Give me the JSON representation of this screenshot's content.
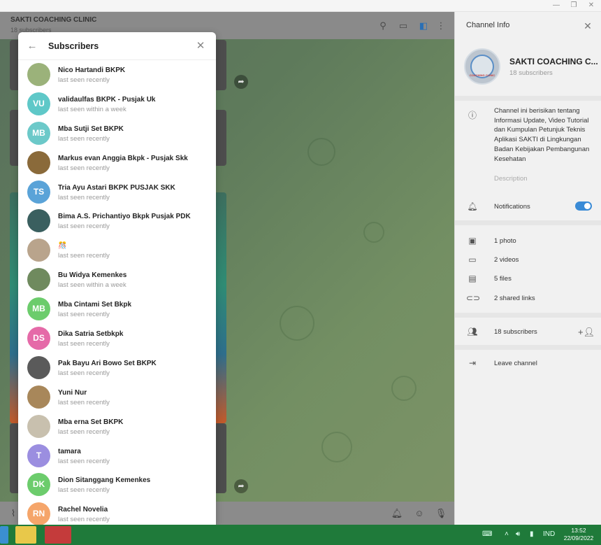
{
  "window": {
    "minimize_icon": "minimize-icon",
    "restore_icon": "restore-icon",
    "close_icon": "close-icon"
  },
  "chat": {
    "title": "SAKTI COACHING CLINIC",
    "subtitle": "18 subscribers"
  },
  "dialog": {
    "title": "Subscribers",
    "subscribers": [
      {
        "name": "Nico Hartandi BKPK",
        "status": "last seen recently",
        "initials": "",
        "color": "#9bb27a"
      },
      {
        "name": "validaulfas BKPK - Pusjak Uk",
        "status": "last seen within a week",
        "initials": "VU",
        "color": "#5fc8c8"
      },
      {
        "name": "Mba Sutji Set BKPK",
        "status": "last seen recently",
        "initials": "MB",
        "color": "#6cc9c9"
      },
      {
        "name": "Markus evan Anggia Bkpk - Pusjak Skk",
        "status": "last seen recently",
        "initials": "",
        "color": "#8a6a3a"
      },
      {
        "name": "Tria Ayu Astari BKPK PUSJAK SKK",
        "status": "last seen recently",
        "initials": "TS",
        "color": "#5aa3d8"
      },
      {
        "name": "Bima A.S. Prichantiyo Bkpk Pusjak PDK",
        "status": "last seen recently",
        "initials": "",
        "color": "#3a5f5f"
      },
      {
        "name": "🎊",
        "status": "last seen recently",
        "initials": "",
        "color": "#b9a48c"
      },
      {
        "name": "Bu Widya Kemenkes",
        "status": "last seen within a week",
        "initials": "",
        "color": "#6f8a5e"
      },
      {
        "name": "Mba Cintami Set Bkpk",
        "status": "last seen recently",
        "initials": "MB",
        "color": "#6ccc6c"
      },
      {
        "name": "Dika Satria Setbkpk",
        "status": "last seen recently",
        "initials": "DS",
        "color": "#e56aa8"
      },
      {
        "name": "Pak Bayu Ari Bowo Set BKPK",
        "status": "last seen recently",
        "initials": "",
        "color": "#5a5a5a"
      },
      {
        "name": "Yuni Nur",
        "status": "last seen recently",
        "initials": "",
        "color": "#a8875a"
      },
      {
        "name": "Mba erna Set BKPK",
        "status": "last seen recently",
        "initials": "",
        "color": "#c8c0ae"
      },
      {
        "name": "tamara",
        "status": "last seen recently",
        "initials": "T",
        "color": "#9b8ee0"
      },
      {
        "name": "Dion Sitanggang Kemenkes",
        "status": "last seen recently",
        "initials": "DK",
        "color": "#6ccc6c"
      },
      {
        "name": "Rachel Novelia",
        "status": "last seen recently",
        "initials": "RN",
        "color": "#f5a56a"
      }
    ]
  },
  "channel_info": {
    "title": "Channel Info",
    "name": "SAKTI COACHING C...",
    "subscribers_count": "18 subscribers",
    "description": "Channel ini berisikan tentang Informasi Update, Video Tutorial dan Kumpulan Petunjuk Teknis Aplikasi SAKTI di Lingkungan Badan Kebijakan Pembangunan Kesehatan",
    "description_label": "Description",
    "notifications_label": "Notifications",
    "notifications_on": true,
    "media": {
      "photos": "1 photo",
      "videos": "2 videos",
      "files": "5 files",
      "links": "2 shared links"
    },
    "subscribers_label": "18 subscribers",
    "leave_label": "Leave channel",
    "avatar_text": "COACHING CLINIC"
  },
  "taskbar": {
    "language": "IND",
    "time": "13:52",
    "date": "22/09/2022"
  },
  "colors": {
    "accent": "#3a8bd6",
    "taskbar": "#1f7a3a",
    "chat_bg": "#6a8660"
  }
}
